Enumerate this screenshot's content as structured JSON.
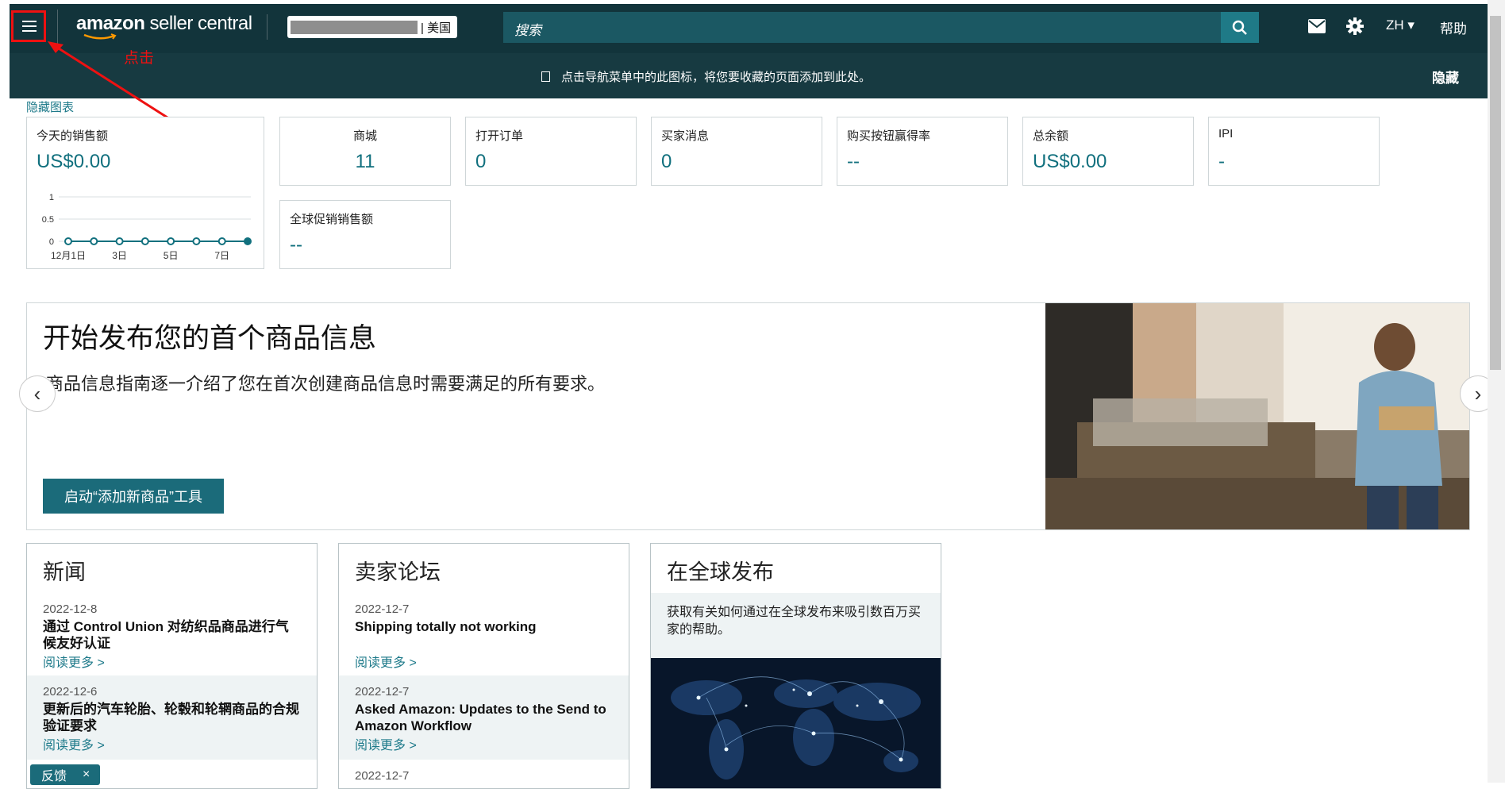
{
  "header": {
    "logo_bold": "amazon",
    "logo_thin": " seller central",
    "marketplace": "| 美国",
    "search_placeholder": "搜索",
    "language": "ZH ▾",
    "help": "帮助"
  },
  "bookmark_bar": {
    "hint": "点击导航菜单中的此图标，将您要收藏的页面添加到此处。",
    "hide": "隐藏"
  },
  "annotation": {
    "click_label": "点击"
  },
  "hide_charts": "隐藏图表",
  "metrics": {
    "sales_today": {
      "label": "今天的销售额",
      "value": "US$0.00"
    },
    "store": {
      "label": "商城",
      "value": "11"
    },
    "open_orders": {
      "label": "打开订单",
      "value": "0"
    },
    "buyer_messages": {
      "label": "买家消息",
      "value": "0"
    },
    "buy_box": {
      "label": "购买按钮赢得率",
      "value": "--"
    },
    "total_balance": {
      "label": "总余额",
      "value": "US$0.00"
    },
    "ipi": {
      "label": "IPI",
      "value": "-"
    },
    "global_promo": {
      "label": "全球促销销售额",
      "value": "--"
    }
  },
  "chart_data": {
    "type": "line",
    "title": "",
    "y_ticks": [
      "1",
      "0.5",
      "0"
    ],
    "ylim": [
      0,
      1
    ],
    "x_tick_labels": [
      "12月1日",
      "3日",
      "5日",
      "7日"
    ],
    "x": [
      "12月1日",
      "2日",
      "3日",
      "4日",
      "5日",
      "6日",
      "7日",
      "8日"
    ],
    "values": [
      0,
      0,
      0,
      0,
      0,
      0,
      0,
      0
    ]
  },
  "hero": {
    "title": "开始发布您的首个商品信息",
    "description": "商品信息指南逐一介绍了您在首次创建商品信息时需要满足的所有要求。",
    "button": "启动“添加新商品”工具"
  },
  "news": {
    "title": "新闻",
    "items": [
      {
        "date": "2022-12-8",
        "title": "通过 Control Union 对纺织品商品进行气候友好认证",
        "more": "阅读更多 >"
      },
      {
        "date": "2022-12-6",
        "title": "更新后的汽车轮胎、轮毂和轮辋商品的合规验证要求",
        "more": "阅读更多 >"
      }
    ]
  },
  "forum": {
    "title": "卖家论坛",
    "items": [
      {
        "date": "2022-12-7",
        "title": "Shipping totally not working",
        "more": "阅读更多 >"
      },
      {
        "date": "2022-12-7",
        "title": "Asked Amazon: Updates to the Send to Amazon Workflow",
        "more": "阅读更多 >"
      },
      {
        "date": "2022-12-7"
      }
    ]
  },
  "global": {
    "title": "在全球发布",
    "description": "获取有关如何通过在全球发布来吸引数百万买家的帮助。"
  },
  "feedback": {
    "label": "反馈",
    "close": "×"
  },
  "colors": {
    "header": "#12343b",
    "accent": "#1b6b7a",
    "link": "#1e7a8a",
    "annotation": "#e11111"
  }
}
